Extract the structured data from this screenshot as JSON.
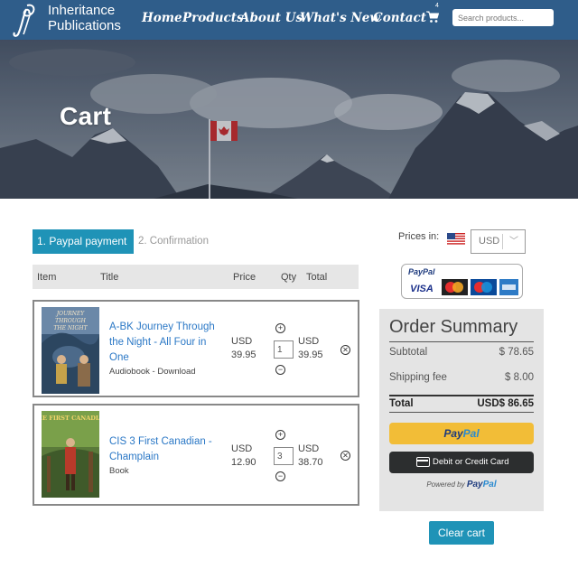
{
  "brand": {
    "line1": "Inheritance",
    "line2": "Publications"
  },
  "nav": {
    "items": [
      {
        "label": "Home"
      },
      {
        "label": "Products"
      },
      {
        "label": "About Us"
      },
      {
        "label": "What's New"
      },
      {
        "label": "Contact"
      }
    ],
    "cart_count": "4",
    "search_placeholder": "Search products..."
  },
  "hero": {
    "title": "Cart"
  },
  "steps": {
    "active": "1. Paypal payment",
    "next": "2. Confirmation"
  },
  "table": {
    "headers": {
      "item": "Item",
      "title": "Title",
      "price": "Price",
      "qty": "Qty",
      "total": "Total"
    }
  },
  "cart_items": [
    {
      "title": "A-BK Journey Through the Night - All Four in One",
      "type": "Audiobook - Download",
      "price_currency": "USD",
      "price": "39.95",
      "qty": "1",
      "total_currency": "USD",
      "total": "39.95",
      "cover_text": "JOURNEY THROUGH THE NIGHT"
    },
    {
      "title": "CIS 3 First Canadian - Champlain",
      "type": "Book",
      "price_currency": "USD",
      "price": "12.90",
      "qty": "3",
      "total_currency": "USD",
      "total": "38.70",
      "cover_text": "THE FIRST CANADIAN"
    }
  ],
  "currency": {
    "label": "Prices in:",
    "selected": "USD"
  },
  "payment_logos": {
    "paypal": "PayPal",
    "visa": "VISA"
  },
  "summary": {
    "title": "Order Summary",
    "subtotal_label": "Subtotal",
    "subtotal": "$ 78.65",
    "shipping_label": "Shipping fee",
    "shipping": "$ 8.00",
    "total_label": "Total",
    "total": "USD$ 86.65",
    "paypal_button_a": "Pay",
    "paypal_button_b": "Pal",
    "card_button": "Debit or Credit Card",
    "powered_by": "Powered by",
    "powered_brand_a": "Pay",
    "powered_brand_b": "Pal"
  },
  "clear_cart": "Clear cart",
  "colors": {
    "nav": "#2f5d8a",
    "accent": "#1f93b7",
    "link": "#2b78c6",
    "paypal_yellow": "#f2bd37"
  }
}
